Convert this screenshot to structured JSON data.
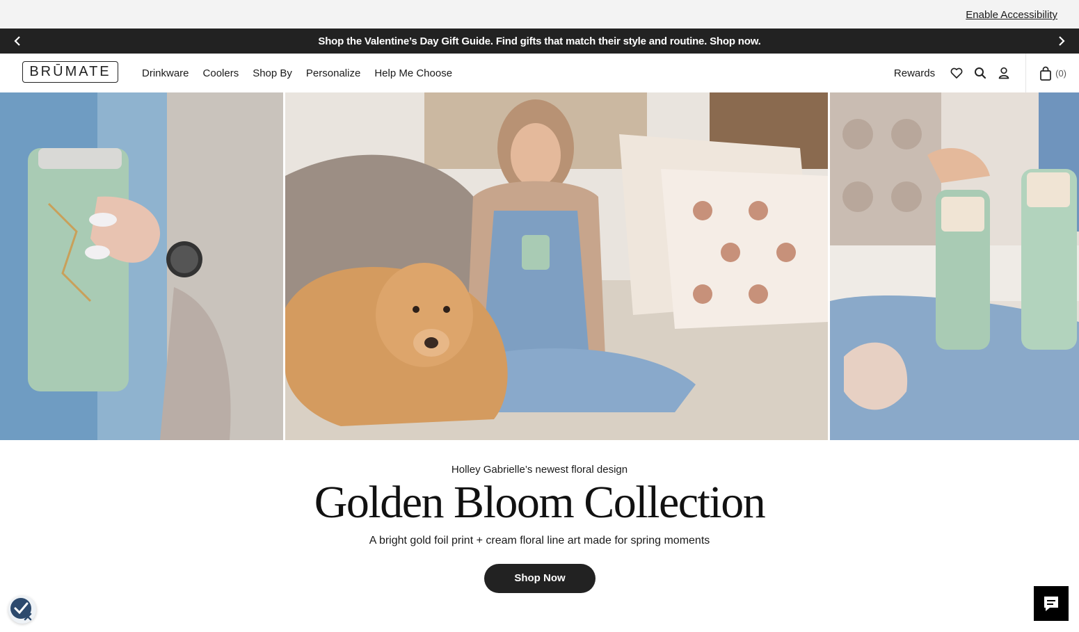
{
  "utility": {
    "accessibility_link": "Enable Accessibility"
  },
  "promo": {
    "message": "Shop the Valentine’s Day Gift Guide. Find gifts that match their style and routine. Shop now.",
    "prev_icon": "chevron-left-icon",
    "next_icon": "chevron-right-icon"
  },
  "nav": {
    "logo": "BRŪMATE",
    "items": [
      "Drinkware",
      "Coolers",
      "Shop By",
      "Personalize",
      "Help Me Choose"
    ],
    "rewards": "Rewards",
    "icons": [
      "heart-icon",
      "search-icon",
      "user-icon",
      "bag-icon"
    ],
    "cart_count": "(0)"
  },
  "hero": {
    "panels": [
      "left-tumbler-photo",
      "center-lifestyle-photo",
      "right-bottles-photo"
    ]
  },
  "copy": {
    "eyebrow": "Holley Gabrielle’s newest floral design",
    "headline": "Golden Bloom Collection",
    "subhead": "A bright gold foil print + cream floral line art made for spring moments",
    "cta": "Shop Now"
  },
  "widgets": {
    "accessibility_icon": "accessibility-check-icon",
    "chat_icon": "chat-icon"
  },
  "colors": {
    "dark": "#222222",
    "util_bg": "#f3f3f3",
    "mint": "#a9cbb4"
  }
}
